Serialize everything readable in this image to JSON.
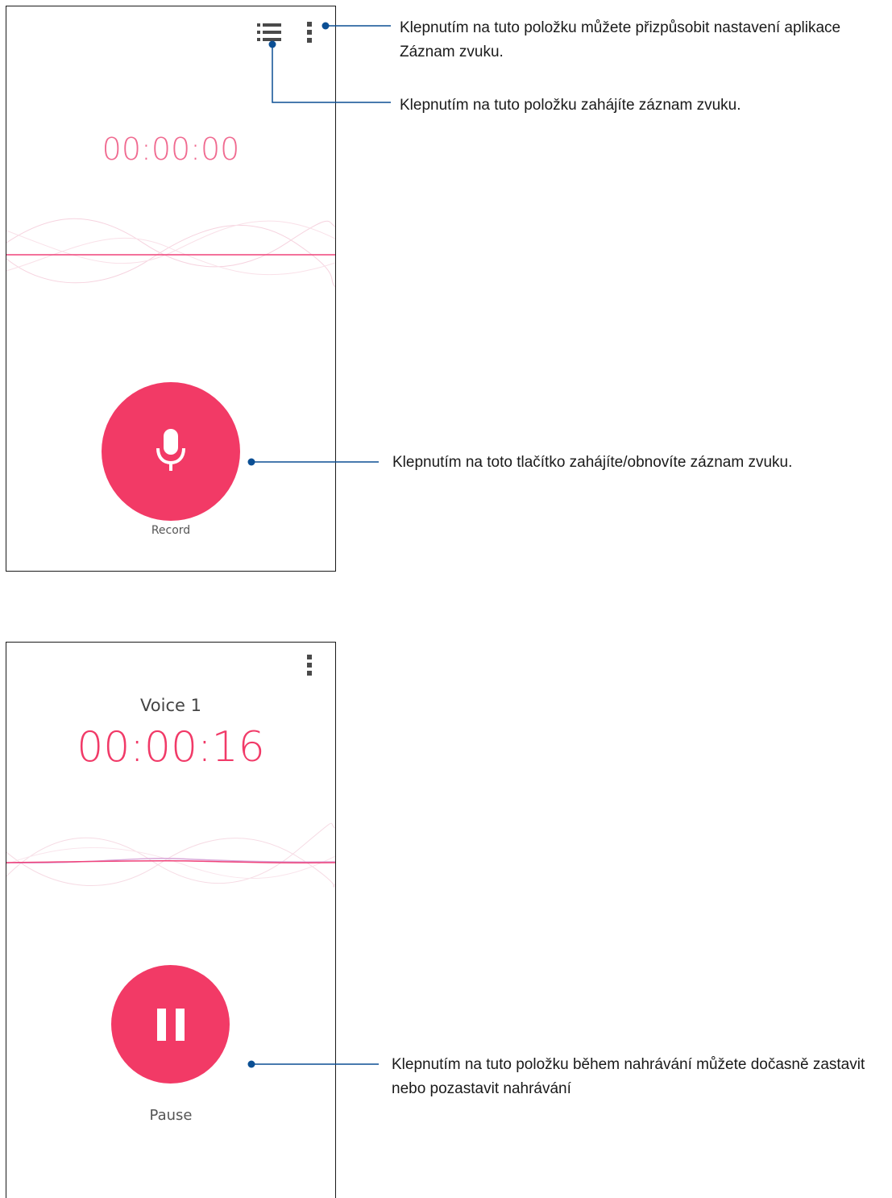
{
  "screen_idle": {
    "timer": "00:00:00",
    "record_label": "Record"
  },
  "screen_recording": {
    "title": "Voice 1",
    "timer": "00:00:16",
    "pause_label": "Pause"
  },
  "callouts": {
    "settings": "Klepnutím na tuto položku můžete přizpůsobit nastavení aplikace Záznam zvuku.",
    "list": "Klepnutím na tuto položku zahájíte záznam zvuku.",
    "record": "Klepnutím na toto tlačítko zahájíte/obnovíte záznam zvuku.",
    "pause": "Klepnutím na tuto položku během nahrávání můžete dočasně zastavit nebo pozastavit nahrávání"
  },
  "icons": {
    "list": "list-icon",
    "menu": "more-vert-icon",
    "mic": "microphone-icon",
    "pause": "pause-icon"
  },
  "colors": {
    "accent": "#f23a66",
    "timer_idle": "#f06a90",
    "callout_line": "#0b4f94"
  }
}
